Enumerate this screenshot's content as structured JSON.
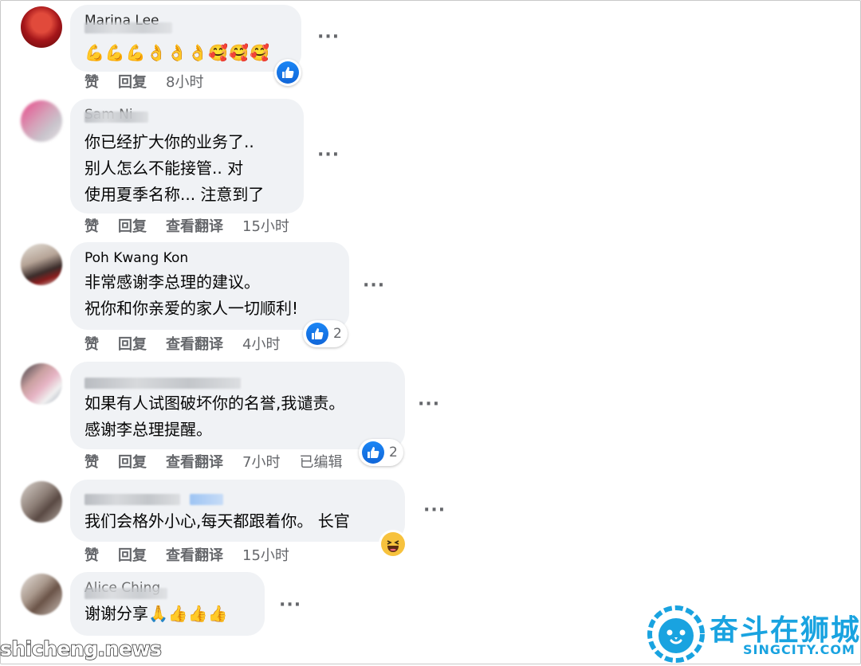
{
  "comments": [
    {
      "author": "Marina Lee",
      "text_lines": [],
      "emoji_line": "💪💪💪👌👌👌🥰🥰🥰",
      "actions": {
        "like": "赞",
        "reply": "回复"
      },
      "time": "8小时",
      "reaction_count": ""
    },
    {
      "author": "Sam Ni",
      "text_lines": [
        "你已经扩大你的业务了..",
        "别人怎么不能接管.. 对",
        "使用夏季名称... 注意到了"
      ],
      "actions": {
        "like": "赞",
        "reply": "回复",
        "translate": "查看翻译"
      },
      "time": "15小时"
    },
    {
      "author": "Poh Kwang Kon",
      "text_lines": [
        "非常感谢李总理的建议。",
        "祝你和你亲爱的家人一切顺利!"
      ],
      "actions": {
        "like": "赞",
        "reply": "回复",
        "translate": "查看翻译"
      },
      "time": "4小时",
      "reaction_count": "2"
    },
    {
      "author": "",
      "text_lines": [
        "如果有人试图破坏你的名誉,我谴责。",
        "感谢李总理提醒。"
      ],
      "actions": {
        "like": "赞",
        "reply": "回复",
        "translate": "查看翻译"
      },
      "time": "7小时",
      "edited": "已编辑",
      "reaction_count": "2"
    },
    {
      "author": "",
      "text_lines": [
        "我们会格外小心,每天都跟着你。 长官"
      ],
      "actions": {
        "like": "赞",
        "reply": "回复",
        "translate": "查看翻译"
      },
      "time": "15小时"
    },
    {
      "author": "Alice Ching",
      "text_lines": [
        "谢谢分享🙏👍👍👍"
      ],
      "actions": {}
    }
  ],
  "watermark": {
    "left": "shicheng.news",
    "brand": "奋斗在狮城",
    "brand_sub": "SINGCITY.COM"
  },
  "colors": {
    "bubble": "#f0f2f5",
    "action_text": "#65676b",
    "like_blue": "#1877f2",
    "brand": "#19a3e0"
  },
  "icons": [
    "like-reaction-icon",
    "haha-reaction-icon",
    "more-options-icon",
    "lion-logo-icon"
  ]
}
